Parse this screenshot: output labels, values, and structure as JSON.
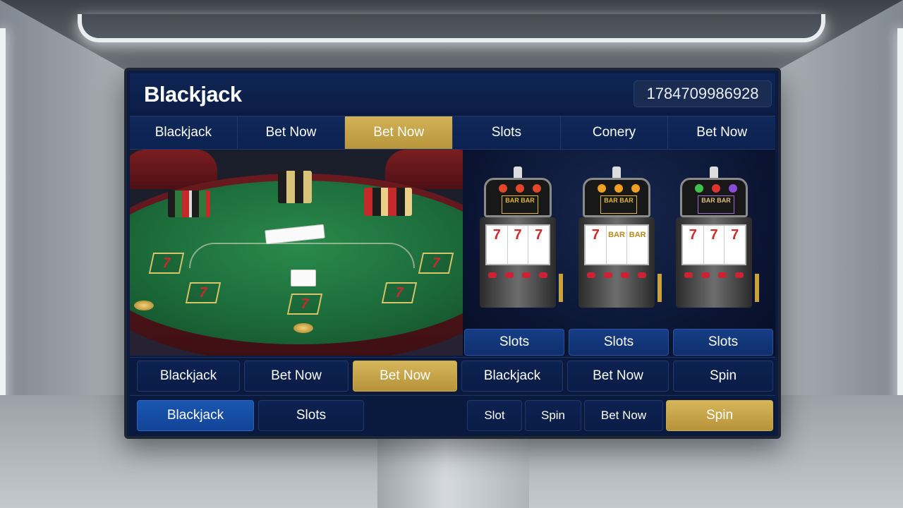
{
  "header": {
    "title": "Blackjack",
    "balance": "1784709986928"
  },
  "tabs": [
    {
      "label": "Blackjack",
      "active": false
    },
    {
      "label": "Bet Now",
      "active": false
    },
    {
      "label": "Bet Now",
      "active": true
    },
    {
      "label": "Slots",
      "active": false
    },
    {
      "label": "Conery",
      "active": false
    },
    {
      "label": "Bet Now",
      "active": false
    }
  ],
  "table": {
    "seven_marks": [
      "7",
      "7",
      "7",
      "7",
      "7"
    ]
  },
  "slot_machines": [
    {
      "topper_text": "BAR BAR",
      "reels": [
        "7",
        "7",
        "7"
      ]
    },
    {
      "topper_text": "BAR BAR",
      "reels": [
        "7",
        "BAR",
        "BAR"
      ]
    },
    {
      "topper_text": "BAR BAR",
      "reels": [
        "7",
        "7",
        "7"
      ]
    }
  ],
  "slot_buttons": [
    "Slots",
    "Slots",
    "Slots"
  ],
  "action_row_1": [
    {
      "label": "Blackjack",
      "style": "dark"
    },
    {
      "label": "Bet Now",
      "style": "dark"
    },
    {
      "label": "Bet Now",
      "style": "gold"
    },
    {
      "label": "Blackjack",
      "style": "dark"
    },
    {
      "label": "Bet Now",
      "style": "dark"
    },
    {
      "label": "Spin",
      "style": "dark"
    }
  ],
  "action_row_2": [
    {
      "label": "Blackjack",
      "style": "blue"
    },
    {
      "label": "Slots",
      "style": "dark"
    },
    {
      "label": "Slot",
      "style": "dark"
    },
    {
      "label": "Spin",
      "style": "dark"
    },
    {
      "label": "Bet Now",
      "style": "dark"
    },
    {
      "label": "Spin",
      "style": "gold"
    }
  ],
  "colors": {
    "accent_gold": "#c9a84d",
    "primary_blue": "#1a56b0",
    "panel_navy": "#0b1b40"
  }
}
